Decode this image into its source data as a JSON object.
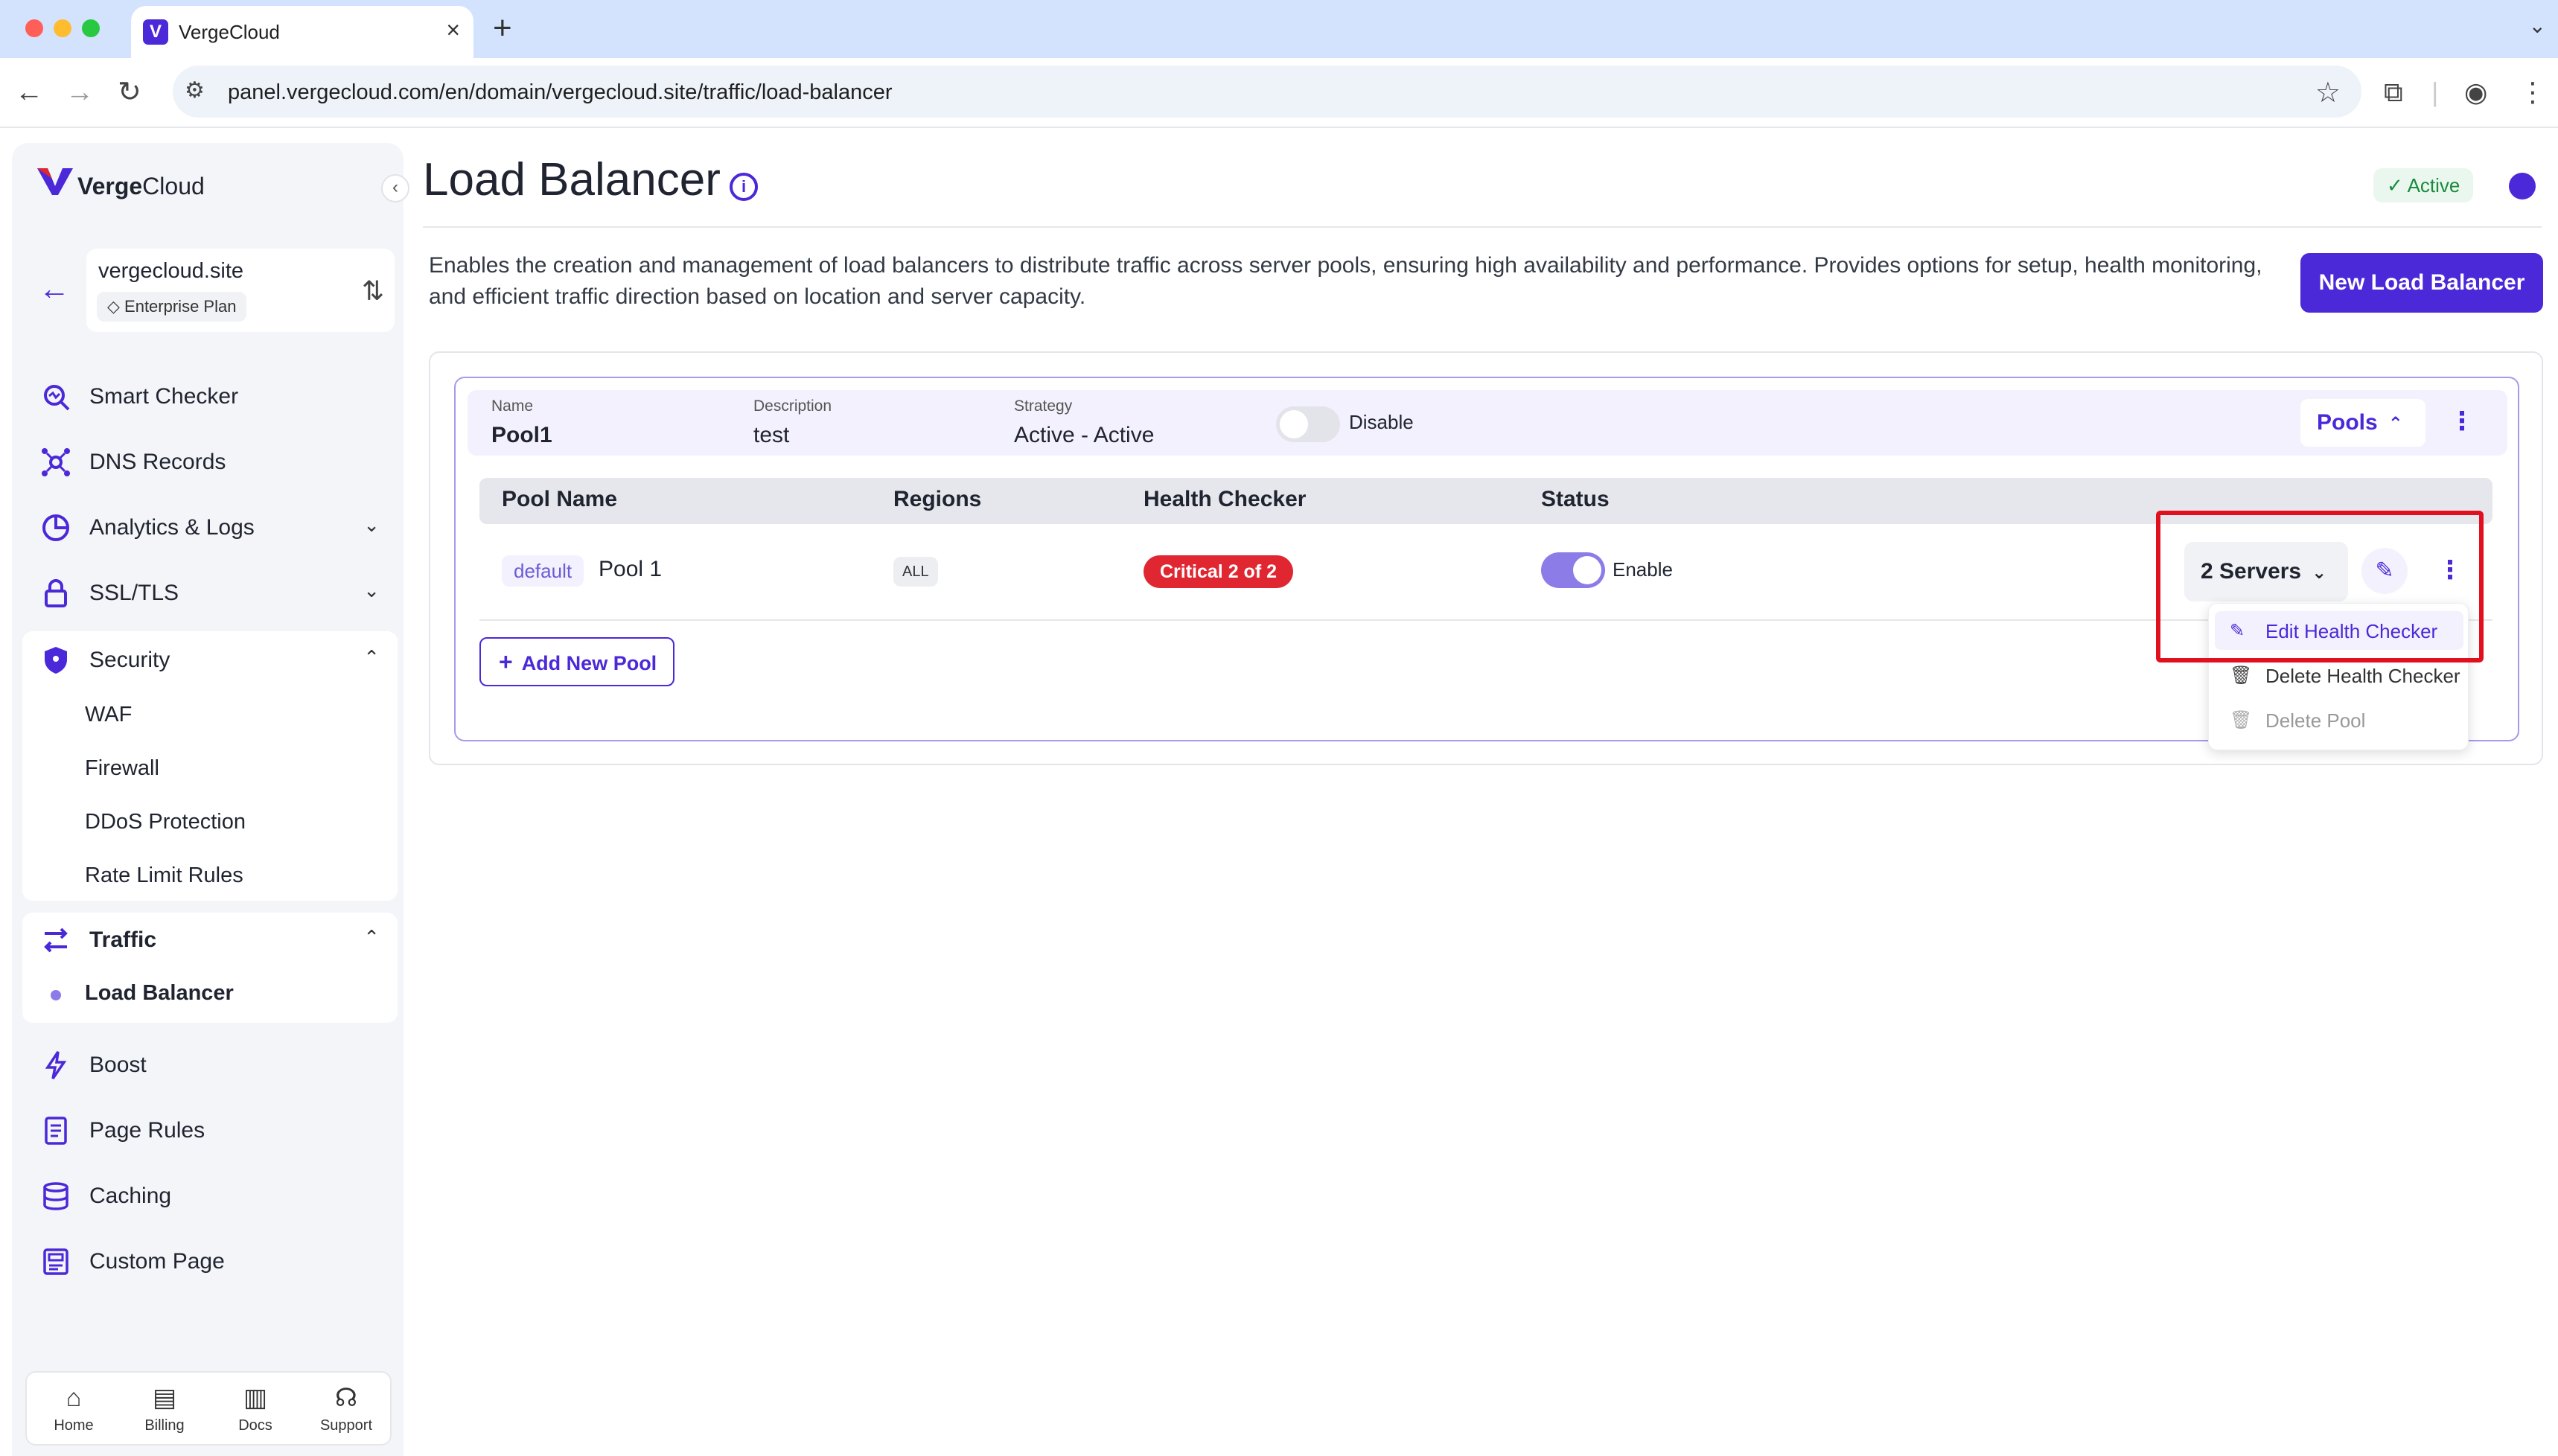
{
  "browser": {
    "tab_title": "VergeCloud",
    "url": "panel.vergecloud.com/en/domain/vergecloud.site/traffic/load-balancer"
  },
  "sidebar": {
    "brand_bold": "Verge",
    "brand_rest": "Cloud",
    "domain": "vergecloud.site",
    "plan": "Enterprise Plan",
    "items": [
      {
        "label": "Smart Checker"
      },
      {
        "label": "DNS Records"
      },
      {
        "label": "Analytics & Logs"
      },
      {
        "label": "SSL/TLS"
      },
      {
        "label": "Security"
      },
      {
        "label": "Traffic"
      },
      {
        "label": "Boost"
      },
      {
        "label": "Page Rules"
      },
      {
        "label": "Caching"
      },
      {
        "label": "Custom Page"
      }
    ],
    "security_sub": [
      "WAF",
      "Firewall",
      "DDoS Protection",
      "Rate Limit Rules"
    ],
    "traffic_sub": [
      "Load Balancer"
    ],
    "bottom": [
      "Home",
      "Billing",
      "Docs",
      "Support"
    ]
  },
  "page": {
    "title": "Load Balancer",
    "status": "Active",
    "description": "Enables the creation and management of load balancers to distribute traffic across server pools, ensuring high availability and performance. Provides options for setup, health monitoring, and efficient traffic direction based on location and server capacity.",
    "new_button": "New Load Balancer"
  },
  "load_balancer": {
    "name_label": "Name",
    "name": "Pool1",
    "description_label": "Description",
    "description": "test",
    "strategy_label": "Strategy",
    "strategy": "Active - Active",
    "toggle_label": "Disable",
    "pools_button": "Pools",
    "columns": [
      "Pool Name",
      "Regions",
      "Health Checker",
      "Status"
    ],
    "pool": {
      "tag": "default",
      "name": "Pool 1",
      "region": "ALL",
      "health": "Critical 2 of 2",
      "status_label": "Enable",
      "enabled": true,
      "servers": "2 Servers"
    },
    "add_pool": "Add New Pool"
  },
  "menu": {
    "items": [
      "Edit Health Checker",
      "Delete Health Checker",
      "Delete Pool"
    ]
  },
  "colors": {
    "brand": "#4b28d8",
    "critical": "#e02630",
    "active": "#1a8a3c",
    "highlight": "#e0101e"
  }
}
